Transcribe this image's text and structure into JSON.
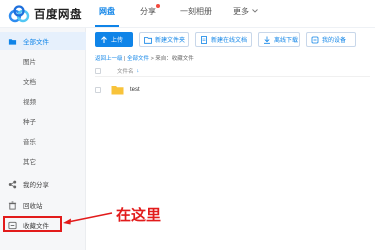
{
  "app": {
    "name": "百度网盘"
  },
  "nav": [
    {
      "label": "网盘",
      "active": true
    },
    {
      "label": "分享",
      "badge": true
    },
    {
      "label": "一刻相册"
    },
    {
      "label": "更多",
      "dropdown": true
    }
  ],
  "sidebar": {
    "items": [
      {
        "label": "全部文件",
        "icon": "folder-icon",
        "active": true
      },
      {
        "label": "图片",
        "sub": true
      },
      {
        "label": "文档",
        "sub": true
      },
      {
        "label": "视频",
        "sub": true
      },
      {
        "label": "种子",
        "sub": true
      },
      {
        "label": "音乐",
        "sub": true
      },
      {
        "label": "其它",
        "sub": true
      },
      {
        "label": "我的分享",
        "icon": "share-icon"
      },
      {
        "label": "回收站",
        "icon": "trash-icon"
      },
      {
        "label": "收藏文件",
        "icon": "star-box-icon"
      }
    ]
  },
  "toolbar": {
    "upload": "上传",
    "new_folder": "新建文件夹",
    "new_doc": "新建在线文档",
    "offline_download": "离线下载",
    "my_devices": "我的设备"
  },
  "breadcrumb": {
    "back": "返回上一级",
    "all_files": "全部文件",
    "separator": "|",
    "path_rest": "> 来自：收藏文件"
  },
  "table": {
    "column_name": "文件名",
    "sort_arrow": "↓",
    "rows": [
      {
        "name": "test",
        "type": "folder"
      }
    ]
  },
  "annotation": {
    "text": "在这里"
  },
  "colors": {
    "accent": "#0f84e8",
    "annotation_red": "#e21b1b",
    "folder_yellow": "#f8c33a"
  }
}
